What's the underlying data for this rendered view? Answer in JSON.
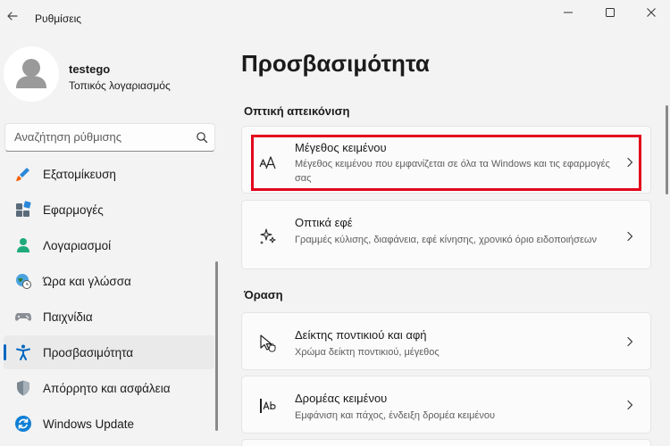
{
  "window": {
    "title": "Ρυθμίσεις"
  },
  "profile": {
    "name": "testego",
    "account_type": "Τοπικός λογαριασμός"
  },
  "search": {
    "placeholder": "Αναζήτηση ρύθμισης"
  },
  "sidebar": {
    "items": [
      {
        "label": "Εξατομίκευση",
        "icon": "paintbrush-icon",
        "selected": false
      },
      {
        "label": "Εφαρμογές",
        "icon": "apps-icon",
        "selected": false
      },
      {
        "label": "Λογαριασμοί",
        "icon": "person-icon",
        "selected": false
      },
      {
        "label": "Ώρα και γλώσσα",
        "icon": "globe-clock-icon",
        "selected": false
      },
      {
        "label": "Παιχνίδια",
        "icon": "gamepad-icon",
        "selected": false
      },
      {
        "label": "Προσβασιμότητα",
        "icon": "accessibility-icon",
        "selected": true
      },
      {
        "label": "Απόρρητο και ασφάλεια",
        "icon": "shield-icon",
        "selected": false
      },
      {
        "label": "Windows Update",
        "icon": "update-icon",
        "selected": false
      }
    ]
  },
  "main": {
    "page_title": "Προσβασιμότητα",
    "sections": [
      {
        "label": "Οπτική απεικόνιση",
        "cards": [
          {
            "title": "Μέγεθος κειμένου",
            "description": "Μέγεθος κειμένου που εμφανίζεται σε όλα τα Windows και τις εφαρμογές σας",
            "icon": "text-size-icon",
            "highlighted": true
          },
          {
            "title": "Οπτικά εφέ",
            "description": "Γραμμές κύλισης, διαφάνεια, εφέ κίνησης, χρονικό όριο ειδοποιήσεων",
            "icon": "sparkle-icon",
            "highlighted": false
          }
        ]
      },
      {
        "label": "Όραση",
        "cards": [
          {
            "title": "Δείκτης ποντικιού και αφή",
            "description": "Χρώμα δείκτη ποντικιού, μέγεθος",
            "icon": "mouse-pointer-icon",
            "highlighted": false
          },
          {
            "title": "Δρομέας κειμένου",
            "description": "Εμφάνιση και πάχος, ένδειξη δρομέα κειμένου",
            "icon": "text-cursor-icon",
            "highlighted": false
          }
        ]
      }
    ]
  },
  "colors": {
    "accent": "#0067c0",
    "highlight_border": "#e3051b",
    "background": "#f3f3f3",
    "card": "#fbfbfb"
  }
}
